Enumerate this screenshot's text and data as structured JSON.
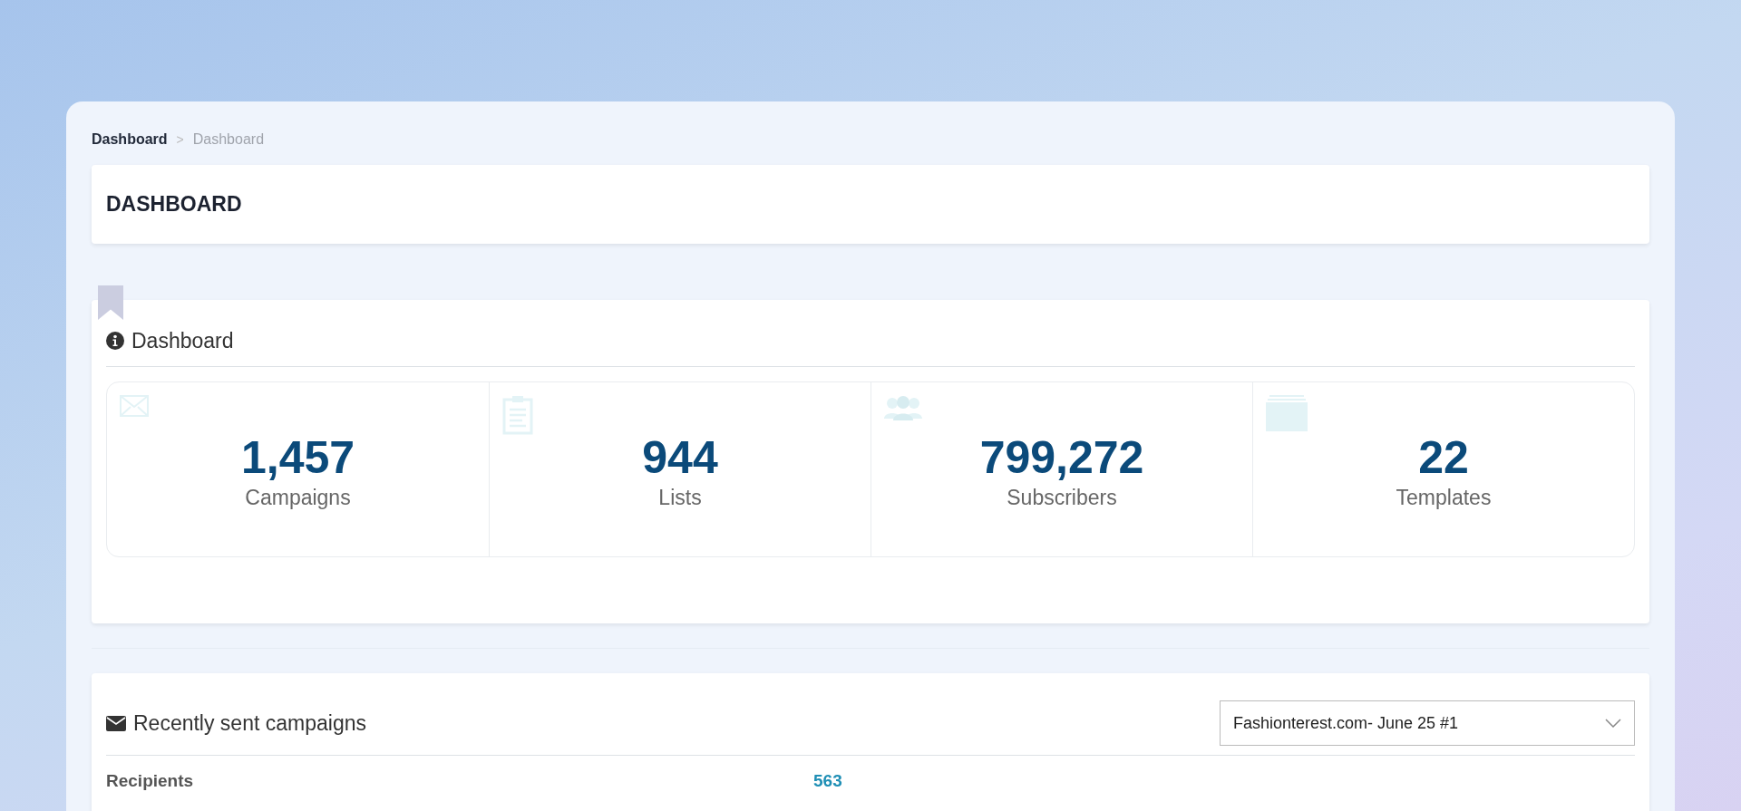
{
  "breadcrumb": [
    {
      "label": "Dashboard",
      "selected": false
    },
    {
      "label": "Dashboard",
      "selected": true
    }
  ],
  "separator": ">",
  "page_title": "DASHBOARD",
  "overview": {
    "title": "Dashboard",
    "stats": [
      {
        "kind": "envelope",
        "value": "1,457",
        "label": "Campaigns"
      },
      {
        "kind": "clipboard",
        "value": "944",
        "label": "Lists"
      },
      {
        "kind": "users",
        "value": "799,272",
        "label": "Subscribers"
      },
      {
        "kind": "stack",
        "value": "22",
        "label": "Templates"
      }
    ]
  },
  "recent": {
    "title": "Recently sent campaigns",
    "campaign_select": "Fashionterest.com- June 25 #1",
    "rows": [
      {
        "label": "Recipients",
        "value": "563"
      }
    ]
  }
}
